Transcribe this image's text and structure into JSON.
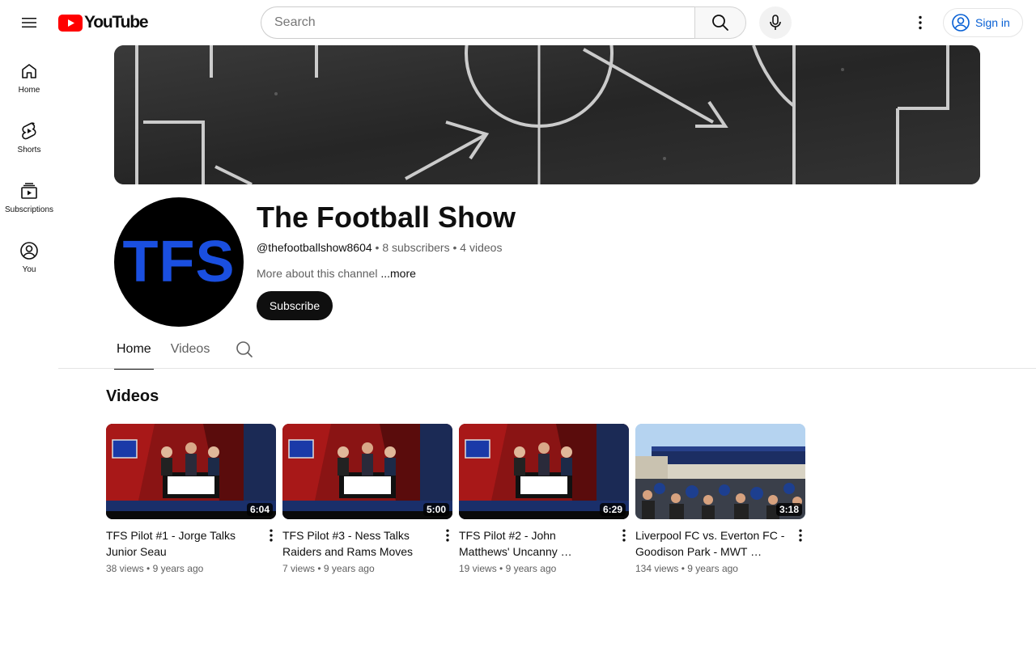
{
  "header": {
    "logo_text": "YouTube",
    "search_placeholder": "Search",
    "sign_in_label": "Sign in"
  },
  "guide": {
    "items": [
      {
        "label": "Home",
        "icon": "home-icon"
      },
      {
        "label": "Shorts",
        "icon": "shorts-icon"
      },
      {
        "label": "Subscriptions",
        "icon": "subscriptions-icon"
      },
      {
        "label": "You",
        "icon": "you-icon"
      }
    ]
  },
  "channel": {
    "name": "The Football Show",
    "avatar_text": "TFS",
    "handle": "@thefootballshow8604",
    "subscribers": "8 subscribers",
    "videos_count": "4 videos",
    "separator": "•",
    "description": "More about this channel",
    "more_label": "...more",
    "subscribe_label": "Subscribe"
  },
  "tabs": [
    {
      "label": "Home",
      "active": true
    },
    {
      "label": "Videos",
      "active": false
    }
  ],
  "section": {
    "title": "Videos"
  },
  "videos": [
    {
      "title": "TFS Pilot #1 - Jorge Talks Junior Seau",
      "duration": "6:04",
      "views": "38 views",
      "age": "9 years ago"
    },
    {
      "title": "TFS Pilot #3 - Ness Talks Raiders and Rams Moves",
      "duration": "5:00",
      "views": "7 views",
      "age": "9 years ago"
    },
    {
      "title": "TFS Pilot #2 - John Matthews' Uncanny …",
      "duration": "6:29",
      "views": "19 views",
      "age": "9 years ago"
    },
    {
      "title": "Liverpool FC vs. Everton FC - Goodison Park - MWT …",
      "duration": "3:18",
      "views": "134 views",
      "age": "9 years ago"
    }
  ],
  "colors": {
    "brand_red": "#ff0000",
    "link_blue": "#065fd4",
    "avatar_text_blue": "#1a4fe0",
    "text_primary": "#0f0f0f",
    "text_secondary": "#606060"
  }
}
